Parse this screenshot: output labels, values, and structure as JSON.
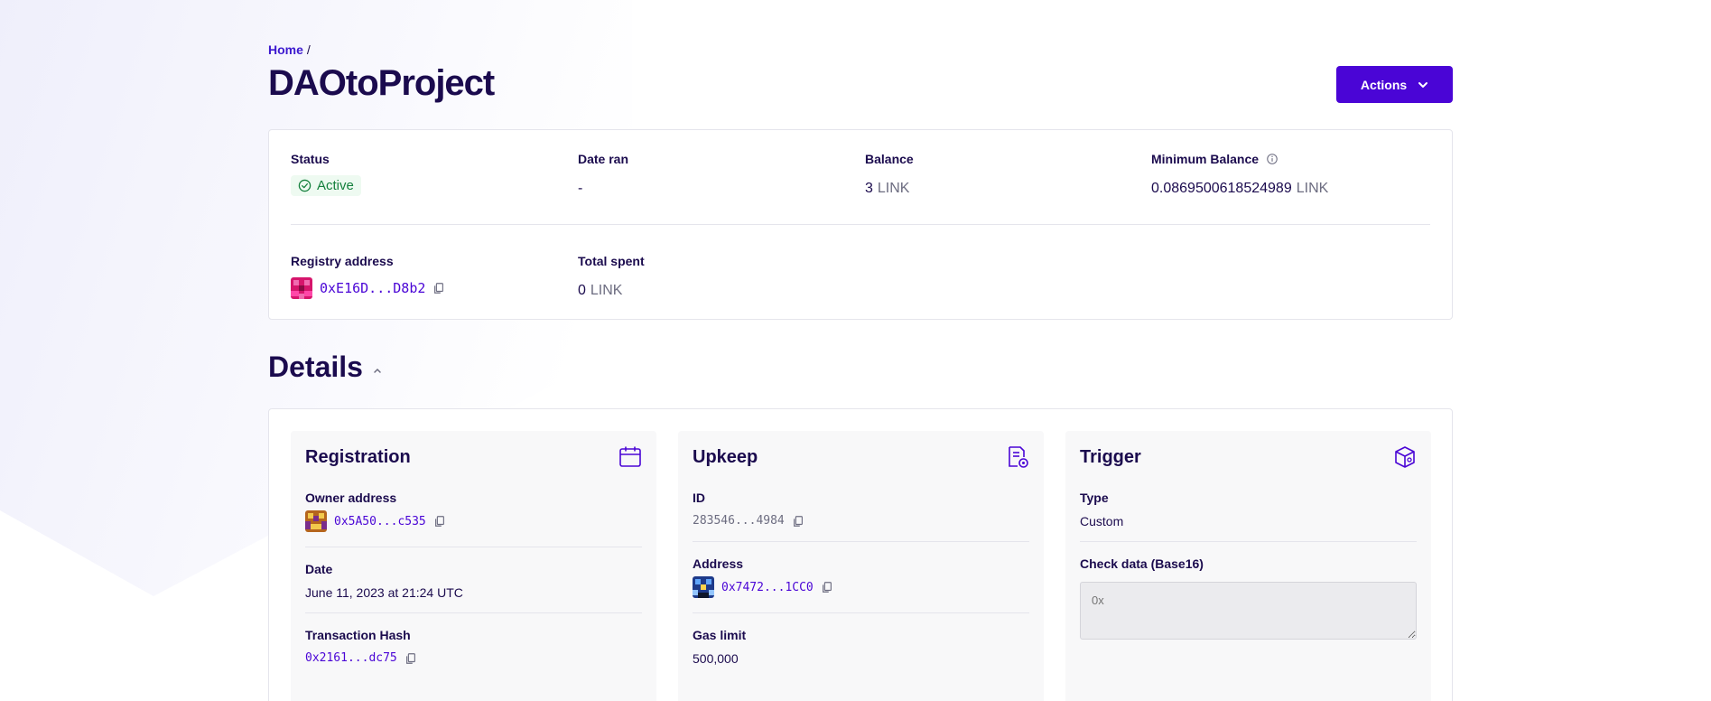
{
  "breadcrumb": {
    "home": "Home",
    "separator": "/"
  },
  "page": {
    "title": "DAOtoProject"
  },
  "actions": {
    "label": "Actions"
  },
  "summary": {
    "status": {
      "label": "Status",
      "value": "Active"
    },
    "date_ran": {
      "label": "Date ran",
      "value": "-"
    },
    "balance": {
      "label": "Balance",
      "value": "3",
      "unit": "LINK"
    },
    "minimum_balance": {
      "label": "Minimum Balance",
      "value": "0.0869500618524989",
      "unit": "LINK"
    },
    "registry_address": {
      "label": "Registry address",
      "value": "0xE16D...D8b2"
    },
    "total_spent": {
      "label": "Total spent",
      "value": "0",
      "unit": "LINK"
    }
  },
  "details": {
    "heading": "Details",
    "registration": {
      "title": "Registration",
      "owner_label": "Owner address",
      "owner_value": "0x5A50...c535",
      "date_label": "Date",
      "date_value": "June 11, 2023 at 21:24 UTC",
      "tx_label": "Transaction Hash",
      "tx_value": "0x2161...dc75"
    },
    "upkeep": {
      "title": "Upkeep",
      "id_label": "ID",
      "id_value": "283546...4984",
      "address_label": "Address",
      "address_value": "0x7472...1CC0",
      "gas_label": "Gas limit",
      "gas_value": "500,000"
    },
    "trigger": {
      "title": "Trigger",
      "type_label": "Type",
      "type_value": "Custom",
      "checkdata_label": "Check data (Base16)",
      "checkdata_placeholder": "0x"
    }
  },
  "colors": {
    "accent": "#4a05d6",
    "text": "#1b0b4e",
    "active": "#15803d"
  },
  "icons": {
    "actions": "chevron-down-icon",
    "status": "check-circle-icon",
    "minimum_balance": "info-icon",
    "copy": "copy-icon",
    "details_toggle": "chevron-up-icon",
    "registration": "calendar-icon",
    "upkeep": "document-gear-icon",
    "trigger": "cube-icon"
  }
}
